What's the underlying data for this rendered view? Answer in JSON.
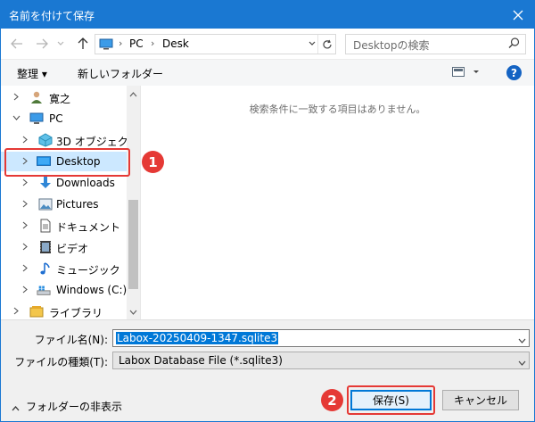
{
  "window": {
    "title": "名前を付けて保存",
    "accent": "#1a78d2"
  },
  "address": {
    "crumbs": [
      "PC",
      "Desk"
    ]
  },
  "search": {
    "placeholder": "Desktopの検索"
  },
  "toolbar": {
    "organize": "整理 ▾",
    "new_folder": "新しいフォルダー",
    "help": "?"
  },
  "tree": {
    "items": [
      {
        "label": "寛之",
        "icon": "user-icon"
      },
      {
        "label": "PC",
        "icon": "computer-icon"
      },
      {
        "label": "3D オブジェクト",
        "icon": "3d-objects-icon"
      },
      {
        "label": "Desktop",
        "icon": "desktop-icon",
        "selected": true
      },
      {
        "label": "Downloads",
        "icon": "download-icon"
      },
      {
        "label": "Pictures",
        "icon": "pictures-icon"
      },
      {
        "label": "ドキュメント",
        "icon": "documents-icon"
      },
      {
        "label": "ビデオ",
        "icon": "video-icon"
      },
      {
        "label": "ミュージック",
        "icon": "music-icon"
      },
      {
        "label": "Windows (C:)",
        "icon": "drive-icon"
      },
      {
        "label": "ライブラリ",
        "icon": "library-icon"
      }
    ]
  },
  "content": {
    "empty_message": "検索条件に一致する項目はありません。"
  },
  "form": {
    "filename_label": "ファイル名(N):",
    "filename_value": "Labox-20250409-1347.sqlite3",
    "filetype_label": "ファイルの種類(T):",
    "filetype_value": "Labox Database File (*.sqlite3)",
    "hide_folders": "フォルダーの非表示"
  },
  "buttons": {
    "save": "保存(S)",
    "cancel": "キャンセル"
  },
  "annotations": {
    "badge1": "1",
    "badge2": "2",
    "color": "#e53935"
  }
}
